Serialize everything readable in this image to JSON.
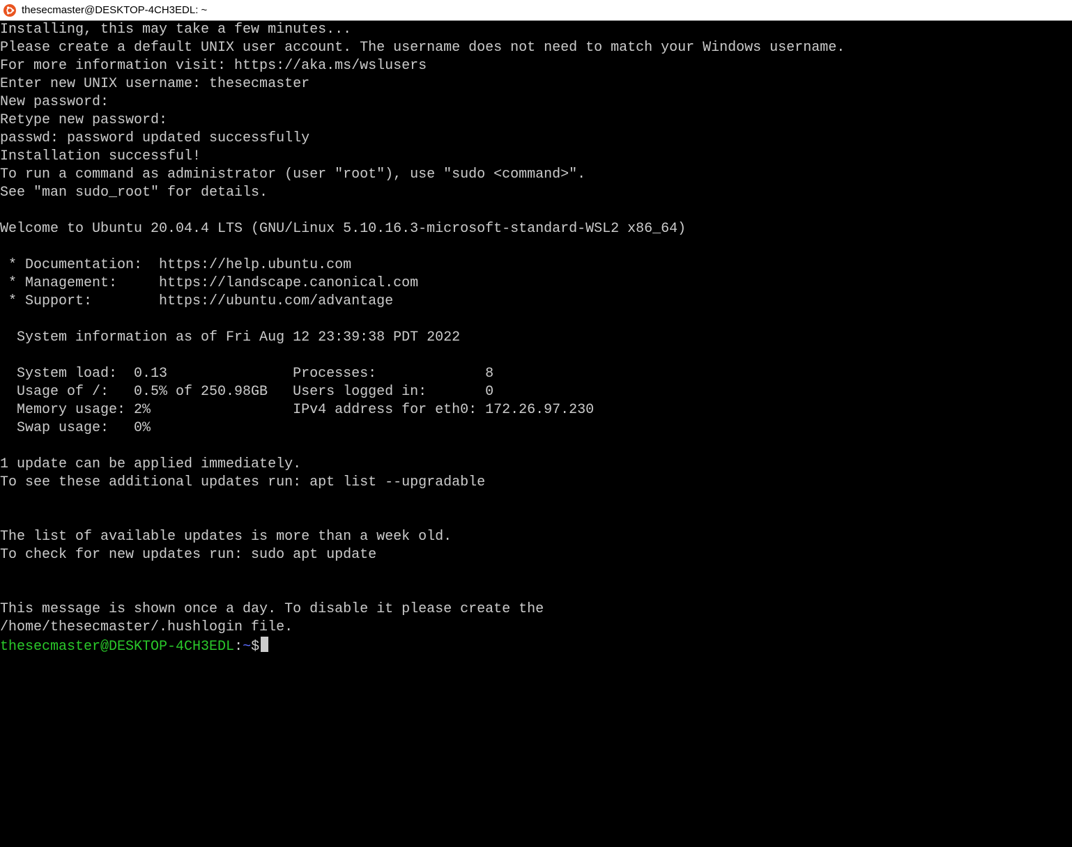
{
  "titlebar": {
    "title": "thesecmaster@DESKTOP-4CH3EDL: ~"
  },
  "lines": {
    "l0": "Installing, this may take a few minutes...",
    "l1": "Please create a default UNIX user account. The username does not need to match your Windows username.",
    "l2": "For more information visit: https://aka.ms/wslusers",
    "l3": "Enter new UNIX username: thesecmaster",
    "l4": "New password:",
    "l5": "Retype new password:",
    "l6": "passwd: password updated successfully",
    "l7": "Installation successful!",
    "l8": "To run a command as administrator (user \"root\"), use \"sudo <command>\".",
    "l9": "See \"man sudo_root\" for details.",
    "l10": "",
    "l11": "Welcome to Ubuntu 20.04.4 LTS (GNU/Linux 5.10.16.3-microsoft-standard-WSL2 x86_64)",
    "l12": "",
    "l13": " * Documentation:  https://help.ubuntu.com",
    "l14": " * Management:     https://landscape.canonical.com",
    "l15": " * Support:        https://ubuntu.com/advantage",
    "l16": "",
    "l17": "  System information as of Fri Aug 12 23:39:38 PDT 2022",
    "l18": "",
    "l19": "  System load:  0.13               Processes:             8",
    "l20": "  Usage of /:   0.5% of 250.98GB   Users logged in:       0",
    "l21": "  Memory usage: 2%                 IPv4 address for eth0: 172.26.97.230",
    "l22": "  Swap usage:   0%",
    "l23": "",
    "l24": "1 update can be applied immediately.",
    "l25": "To see these additional updates run: apt list --upgradable",
    "l26": "",
    "l27": "",
    "l28": "The list of available updates is more than a week old.",
    "l29": "To check for new updates run: sudo apt update",
    "l30": "",
    "l31": "",
    "l32": "This message is shown once a day. To disable it please create the",
    "l33": "/home/thesecmaster/.hushlogin file."
  },
  "prompt": {
    "user_host": "thesecmaster@DESKTOP-4CH3EDL",
    "colon": ":",
    "path": "~",
    "dollar": "$"
  }
}
